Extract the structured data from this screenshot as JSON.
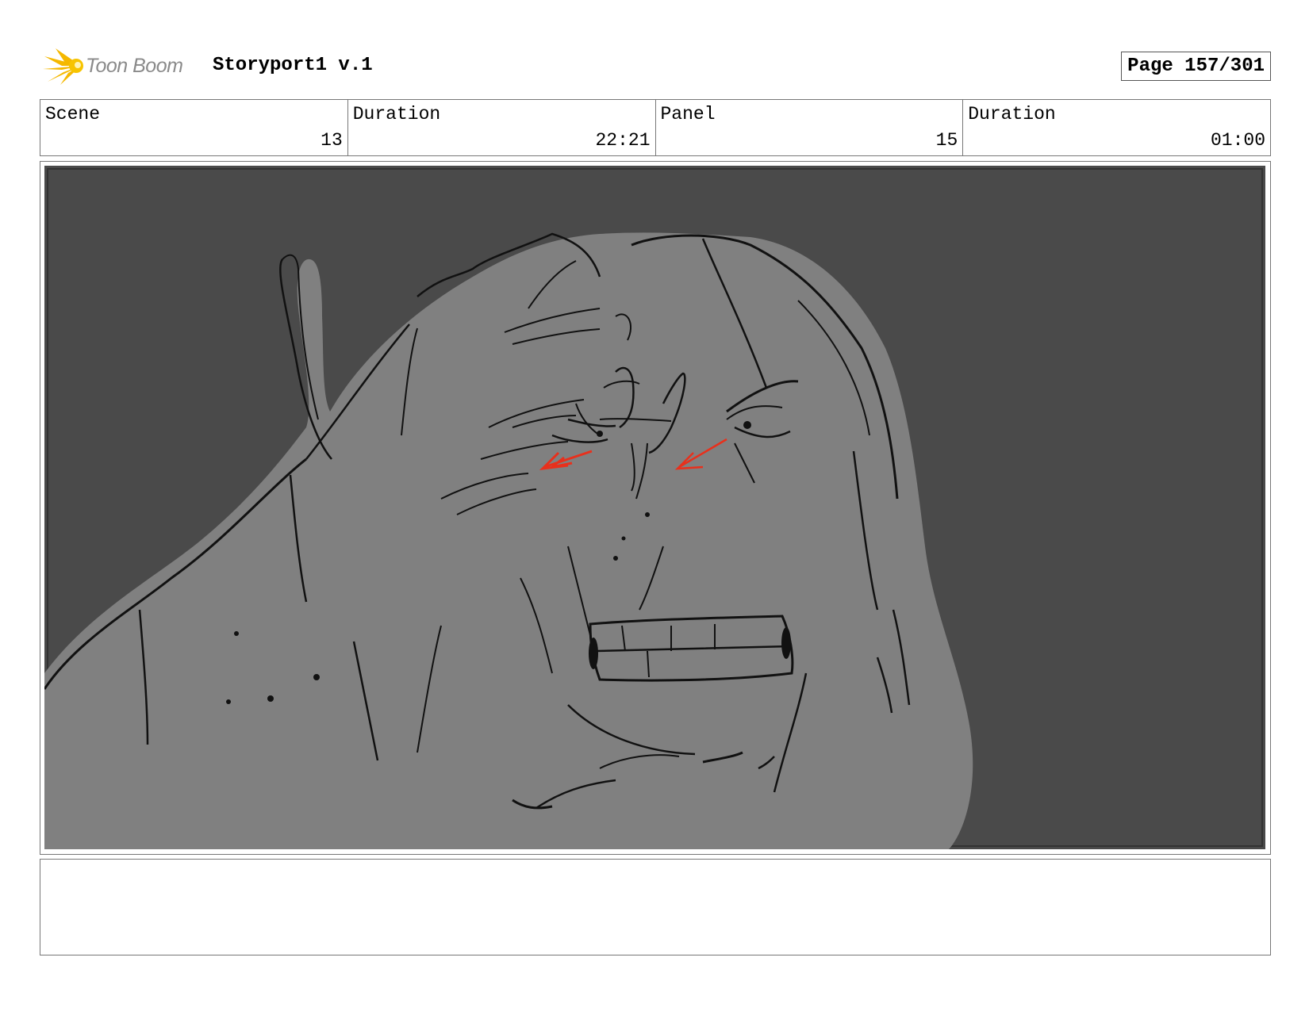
{
  "header": {
    "logo_text": "Toon Boom",
    "project_title": "Storyport1 v.1",
    "page_label": "Page 157/301"
  },
  "info": {
    "scene_label": "Scene",
    "scene_value": "13",
    "scene_duration_label": "Duration",
    "scene_duration_value": "22:21",
    "panel_label": "Panel",
    "panel_value": "15",
    "panel_duration_label": "Duration",
    "panel_duration_value": "01:00"
  },
  "notes": {
    "text": ""
  },
  "colors": {
    "background_dark": "#4a4a4a",
    "figure_gray": "#808080",
    "arrow_red": "#e8301c",
    "logo_yellow": "#f5b800"
  }
}
